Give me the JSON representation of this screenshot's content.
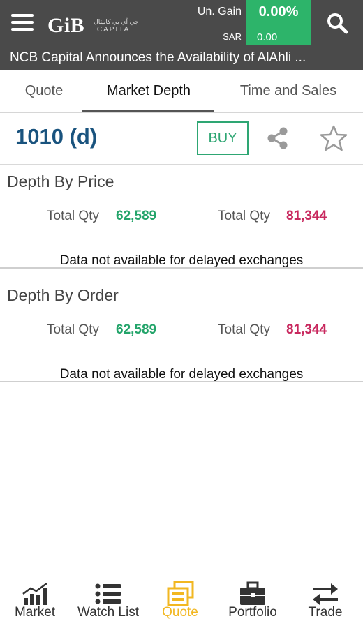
{
  "header": {
    "logo_text": "GiB",
    "logo_arabic": "جي آي بي كابيتال",
    "logo_sub": "CAPITAL",
    "gain_label": "Un. Gain",
    "gain_value": "0.00%",
    "currency_label": "SAR",
    "currency_value": "0.00",
    "ticker": "NCB Capital Announces the Availability of AlAhli ..."
  },
  "tabs": [
    {
      "label": "Quote",
      "active": false
    },
    {
      "label": "Market Depth",
      "active": true
    },
    {
      "label": "Time and Sales",
      "active": false
    }
  ],
  "stock": {
    "symbol": "1010 (d)",
    "buy_label": "BUY"
  },
  "depth_by_price": {
    "title": "Depth By Price",
    "bid_label": "Total Qty",
    "bid_value": "62,589",
    "ask_label": "Total Qty",
    "ask_value": "81,344",
    "message": "Data not available for delayed exchanges"
  },
  "depth_by_order": {
    "title": "Depth By Order",
    "bid_label": "Total Qty",
    "bid_value": "62,589",
    "ask_label": "Total Qty",
    "ask_value": "81,344",
    "message": "Data not available for delayed exchanges"
  },
  "nav": [
    {
      "label": "Market",
      "icon": "market-chart-icon",
      "active": false
    },
    {
      "label": "Watch List",
      "icon": "list-icon",
      "active": false
    },
    {
      "label": "Quote",
      "icon": "quote-icon",
      "active": true
    },
    {
      "label": "Portfolio",
      "icon": "briefcase-icon",
      "active": false
    },
    {
      "label": "Trade",
      "icon": "swap-arrows-icon",
      "active": false
    }
  ],
  "colors": {
    "header_bg": "#4a4a4a",
    "gain_green": "#2db46a",
    "symbol_blue": "#19537e",
    "bid_green": "#23a46a",
    "ask_red": "#c8285e",
    "nav_active": "#f2b721"
  }
}
